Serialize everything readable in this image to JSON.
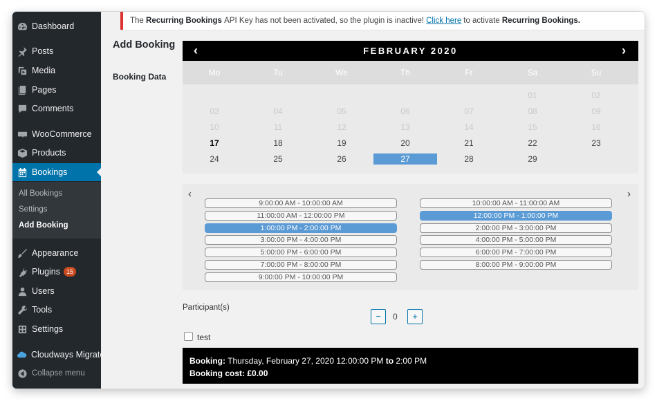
{
  "sidebar": {
    "dashboard": "Dashboard",
    "posts": "Posts",
    "media": "Media",
    "pages": "Pages",
    "comments": "Comments",
    "woocommerce": "WooCommerce",
    "products": "Products",
    "bookings": "Bookings",
    "submenu": {
      "all_bookings": "All Bookings",
      "settings": "Settings",
      "add_booking": "Add Booking"
    },
    "appearance": "Appearance",
    "plugins": "Plugins",
    "plugins_badge": "15",
    "users": "Users",
    "tools": "Tools",
    "settings": "Settings",
    "cloudways": "Cloudways Migrate",
    "collapse": "Collapse menu"
  },
  "notice": {
    "prefix": "The",
    "plugin_name": "Recurring Bookings",
    "middle": "API Key has not been activated, so the plugin is inactive!",
    "link_text": "Click here",
    "suffix": "to activate",
    "plugin_name_2": "Recurring Bookings."
  },
  "page": {
    "title": "Add Booking",
    "booking_data_label": "Booking Data"
  },
  "calendar": {
    "prev": "‹",
    "next": "›",
    "month": "FEBRUARY 2020",
    "weekdays": [
      "Mo",
      "Tu",
      "We",
      "Th",
      "Fr",
      "Sa",
      "Su"
    ],
    "weeks": [
      [
        null,
        null,
        null,
        null,
        null,
        {
          "d": "01",
          "s": "disabled"
        },
        {
          "d": "02",
          "s": "disabled"
        }
      ],
      [
        {
          "d": "03",
          "s": "disabled"
        },
        {
          "d": "04",
          "s": "disabled"
        },
        {
          "d": "05",
          "s": "disabled"
        },
        {
          "d": "06",
          "s": "disabled"
        },
        {
          "d": "07",
          "s": "disabled"
        },
        {
          "d": "08",
          "s": "disabled"
        },
        {
          "d": "09",
          "s": "disabled"
        }
      ],
      [
        {
          "d": "10",
          "s": "disabled"
        },
        {
          "d": "11",
          "s": "disabled"
        },
        {
          "d": "12",
          "s": "disabled"
        },
        {
          "d": "13",
          "s": "disabled"
        },
        {
          "d": "14",
          "s": "disabled"
        },
        {
          "d": "15",
          "s": "disabled"
        },
        {
          "d": "16",
          "s": "disabled"
        }
      ],
      [
        {
          "d": "17",
          "s": "today"
        },
        {
          "d": "18",
          "s": ""
        },
        {
          "d": "19",
          "s": ""
        },
        {
          "d": "20",
          "s": ""
        },
        {
          "d": "21",
          "s": ""
        },
        {
          "d": "22",
          "s": ""
        },
        {
          "d": "23",
          "s": ""
        }
      ],
      [
        {
          "d": "24",
          "s": ""
        },
        {
          "d": "25",
          "s": ""
        },
        {
          "d": "26",
          "s": ""
        },
        {
          "d": "27",
          "s": "selected"
        },
        {
          "d": "28",
          "s": ""
        },
        {
          "d": "29",
          "s": ""
        },
        null
      ]
    ]
  },
  "time_slots": {
    "prev": "‹",
    "next": "›",
    "left": [
      {
        "label": "9:00:00 AM - 10:00:00 AM",
        "selected": false
      },
      {
        "label": "11:00:00 AM - 12:00:00 PM",
        "selected": false
      },
      {
        "label": "1:00:00 PM - 2:00:00 PM",
        "selected": true
      },
      {
        "label": "3:00:00 PM - 4:00:00 PM",
        "selected": false
      },
      {
        "label": "5:00:00 PM - 6:00:00 PM",
        "selected": false
      },
      {
        "label": "7:00:00 PM - 8:00:00 PM",
        "selected": false
      },
      {
        "label": "9:00:00 PM - 10:00:00 PM",
        "selected": false
      }
    ],
    "right": [
      {
        "label": "10:00:00 AM - 11:00:00 AM",
        "selected": false
      },
      {
        "label": "12:00:00 PM - 1:00:00 PM",
        "selected": true
      },
      {
        "label": "2:00:00 PM - 3:00:00 PM",
        "selected": false
      },
      {
        "label": "4:00:00 PM - 5:00:00 PM",
        "selected": false
      },
      {
        "label": "6:00:00 PM - 7:00:00 PM",
        "selected": false
      },
      {
        "label": "8:00:00 PM - 9:00:00 PM",
        "selected": false
      }
    ]
  },
  "participants": {
    "label": "Participant(s)",
    "minus": "−",
    "value": "0",
    "plus": "+"
  },
  "checkbox": {
    "label": "test",
    "checked": false
  },
  "summary": {
    "booking_label": "Booking:",
    "booking_date": "Thursday, February 27, 2020 12:00:00 PM",
    "to": "to",
    "booking_end": "2:00 PM",
    "cost_label": "Booking cost:",
    "cost_value": "£0.00"
  },
  "colors": {
    "sidebar_bg": "#23282d",
    "active_menu": "#0073aa",
    "selected_blue": "#5b9bd5",
    "notice_border": "#dc3232",
    "badge": "#ca4a1f"
  }
}
